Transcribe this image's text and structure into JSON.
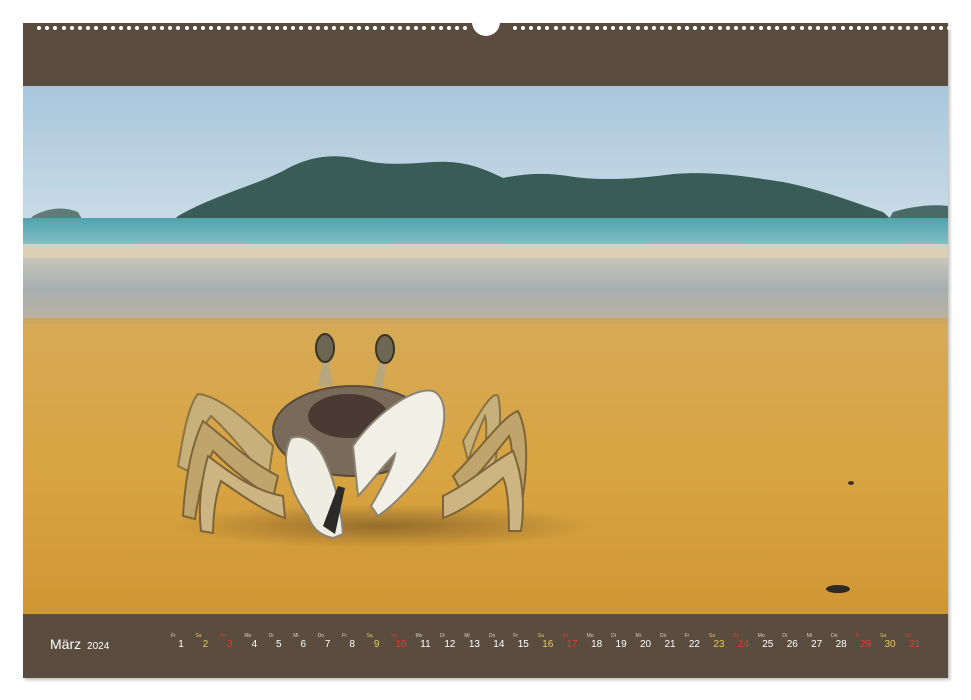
{
  "calendar": {
    "month": "März",
    "year": "2024",
    "days": [
      {
        "wd": "Fr",
        "n": "1",
        "t": "wk"
      },
      {
        "wd": "Sa",
        "n": "2",
        "t": "sat"
      },
      {
        "wd": "So",
        "n": "3",
        "t": "sun"
      },
      {
        "wd": "Mo",
        "n": "4",
        "t": "wk"
      },
      {
        "wd": "Di",
        "n": "5",
        "t": "wk"
      },
      {
        "wd": "Mi",
        "n": "6",
        "t": "wk"
      },
      {
        "wd": "Do",
        "n": "7",
        "t": "wk"
      },
      {
        "wd": "Fr",
        "n": "8",
        "t": "wk"
      },
      {
        "wd": "Sa",
        "n": "9",
        "t": "sat"
      },
      {
        "wd": "So",
        "n": "10",
        "t": "sun"
      },
      {
        "wd": "Mo",
        "n": "11",
        "t": "wk"
      },
      {
        "wd": "Di",
        "n": "12",
        "t": "wk"
      },
      {
        "wd": "Mi",
        "n": "13",
        "t": "wk"
      },
      {
        "wd": "Do",
        "n": "14",
        "t": "wk"
      },
      {
        "wd": "Fr",
        "n": "15",
        "t": "wk"
      },
      {
        "wd": "Sa",
        "n": "16",
        "t": "sat"
      },
      {
        "wd": "So",
        "n": "17",
        "t": "sun"
      },
      {
        "wd": "Mo",
        "n": "18",
        "t": "wk"
      },
      {
        "wd": "Di",
        "n": "19",
        "t": "wk"
      },
      {
        "wd": "Mi",
        "n": "20",
        "t": "wk"
      },
      {
        "wd": "Do",
        "n": "21",
        "t": "wk"
      },
      {
        "wd": "Fr",
        "n": "22",
        "t": "wk"
      },
      {
        "wd": "Sa",
        "n": "23",
        "t": "sat"
      },
      {
        "wd": "So",
        "n": "24",
        "t": "sun"
      },
      {
        "wd": "Mo",
        "n": "25",
        "t": "wk"
      },
      {
        "wd": "Di",
        "n": "26",
        "t": "wk"
      },
      {
        "wd": "Mi",
        "n": "27",
        "t": "wk"
      },
      {
        "wd": "Do",
        "n": "28",
        "t": "wk"
      },
      {
        "wd": "Fr",
        "n": "29",
        "t": "hol"
      },
      {
        "wd": "Sa",
        "n": "30",
        "t": "sat"
      },
      {
        "wd": "So",
        "n": "31",
        "t": "sun"
      }
    ]
  },
  "colors": {
    "frame": "#5a4d3f",
    "saturday": "#e6c95c",
    "sunday": "#e23a2e"
  },
  "photo": {
    "subject": "ghost crab on a sandy beach with an island in the background"
  }
}
